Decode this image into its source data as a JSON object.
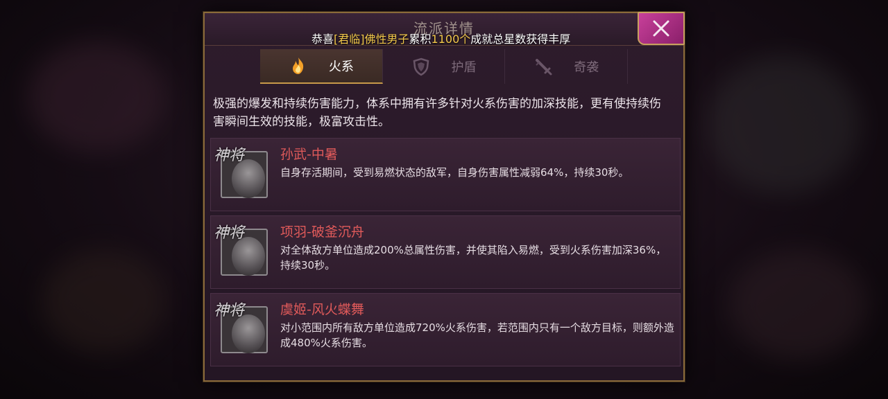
{
  "panel": {
    "title": "流派详情",
    "marquee": {
      "prefix": "恭喜",
      "player": "[君临]佛性男子",
      "mid": "累积",
      "count": "1100个",
      "suffix": "成就总星数获得丰厚"
    },
    "close_icon": "close-x-icon"
  },
  "tabs": [
    {
      "label": "火系",
      "icon": "flame-icon",
      "active": true
    },
    {
      "label": "护盾",
      "icon": "shield-icon",
      "active": false
    },
    {
      "label": "奇袭",
      "icon": "dagger-icon",
      "active": false
    }
  ],
  "description": "极强的爆发和持续伤害能力，体系中拥有许多针对火系伤害的加深技能，更有使持续伤害瞬间生效的技能，极富攻击性。",
  "skills": [
    {
      "name": "孙武-中暑",
      "desc": "自身存活期间，受到易燃状态的敌军，自身伤害属性减弱64%，持续30秒。",
      "seal": "神将"
    },
    {
      "name": "项羽-破釜沉舟",
      "desc": "对全体敌方单位造成200%总属性伤害，并使其陷入易燃，受到火系伤害加深36%，持续30秒。",
      "seal": "神将"
    },
    {
      "name": "虞姬-风火蝶舞",
      "desc": "对小范围内所有敌方单位造成720%火系伤害，若范围内只有一个敌方目标，则额外造成480%火系伤害。",
      "seal": "神将"
    }
  ],
  "colors": {
    "accent_gold": "#c89a4a",
    "skill_name_red": "#e05a5a",
    "highlight_yellow": "#f2c84b",
    "close_magenta": "#c8409a"
  }
}
